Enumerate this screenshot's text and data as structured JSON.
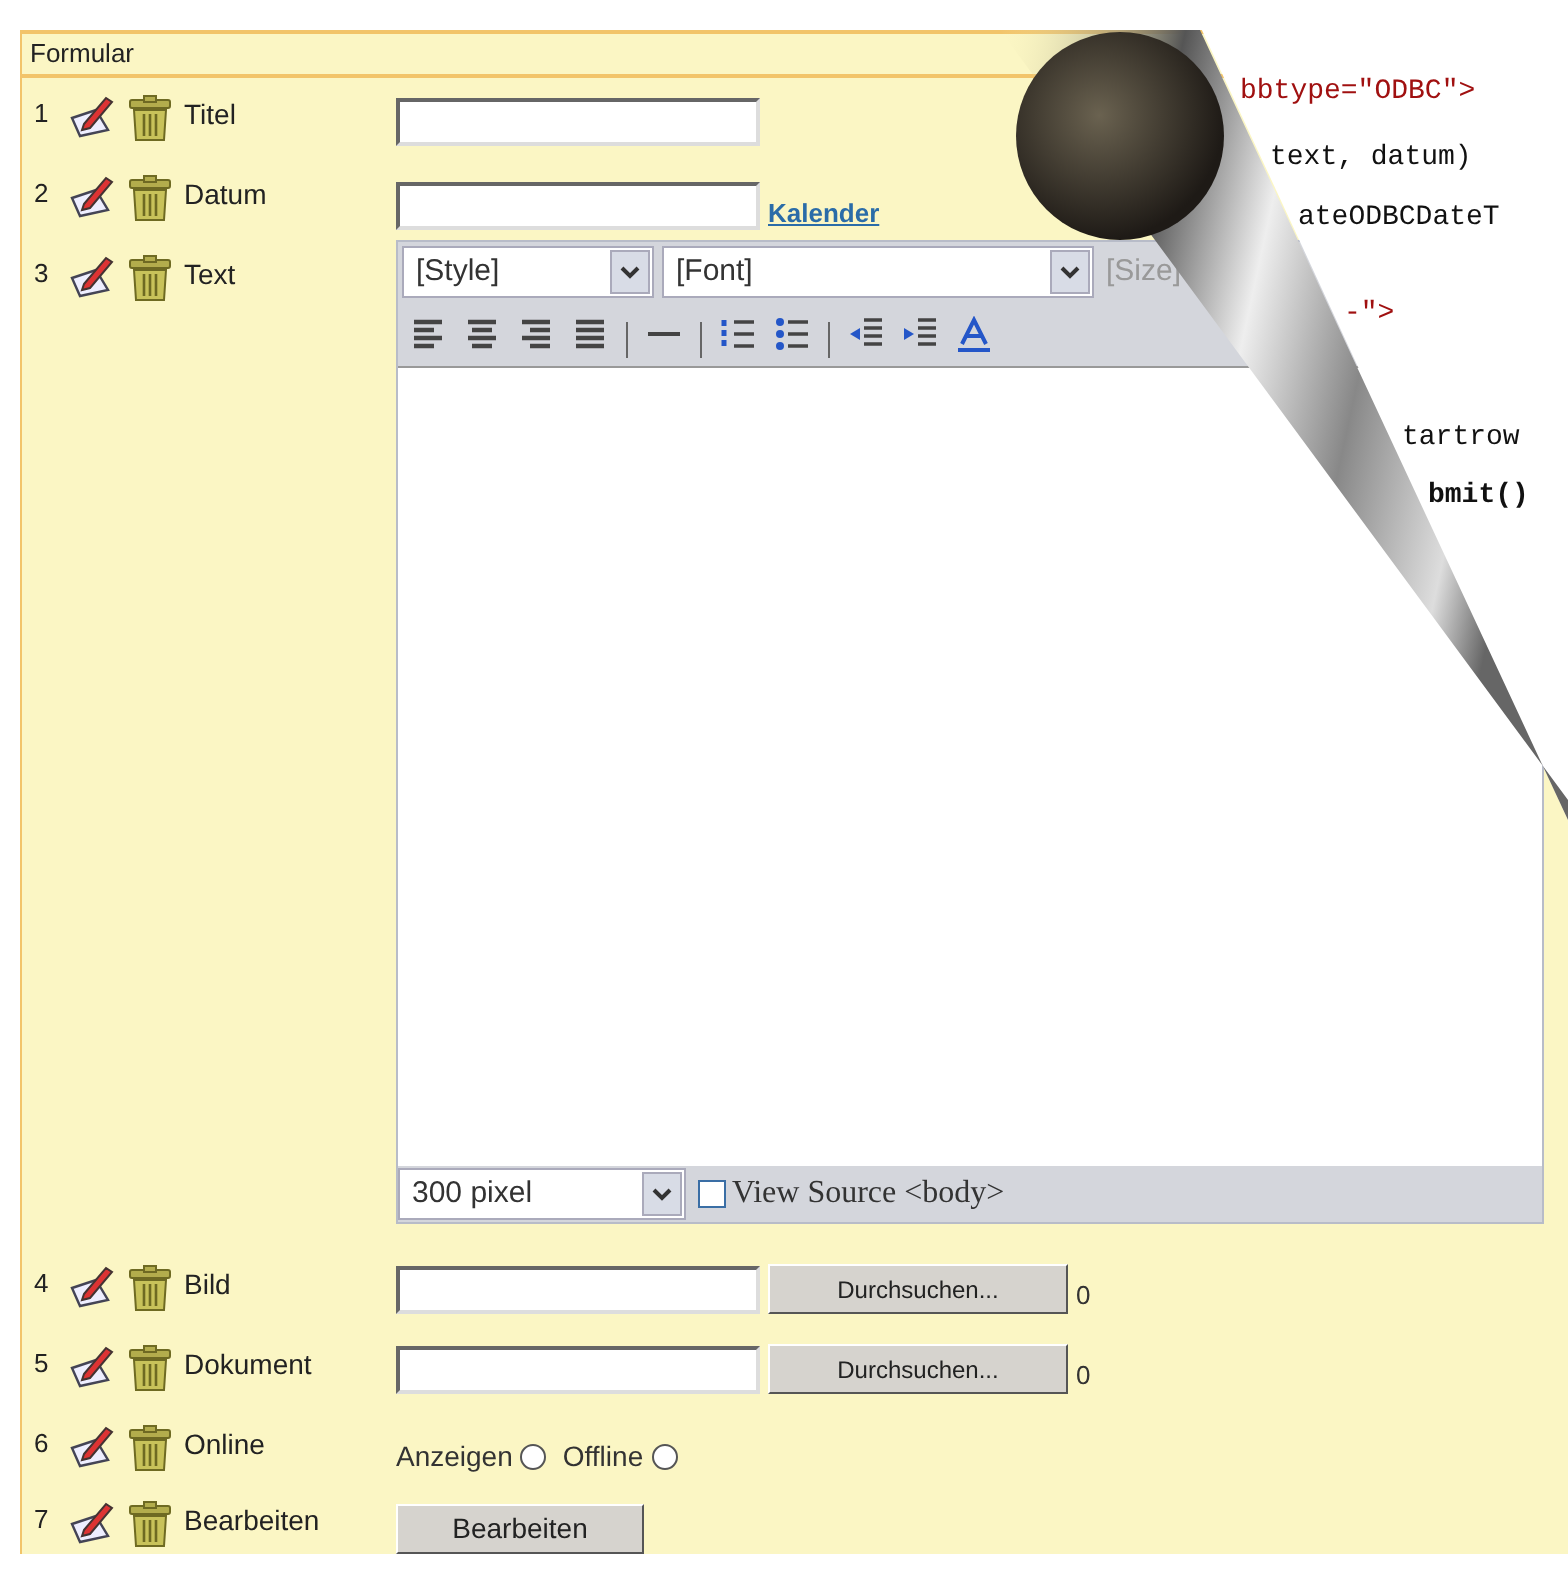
{
  "panel": {
    "title": "Formular"
  },
  "rows": [
    {
      "number": "1",
      "label": "Titel",
      "kind": "text"
    },
    {
      "number": "2",
      "label": "Datum",
      "kind": "date",
      "link": "Kalender"
    },
    {
      "number": "3",
      "label": "Text",
      "kind": "editor",
      "editor": {
        "style": "[Style]",
        "font": "[Font]",
        "size": "[Size]",
        "height": "300 pixel",
        "view_source": {
          "label": "View Source <body>",
          "checked": false
        }
      }
    },
    {
      "number": "4",
      "label": "Bild",
      "kind": "file",
      "button": "Durchsuchen...",
      "count": "0"
    },
    {
      "number": "5",
      "label": "Dokument",
      "kind": "file",
      "button": "Durchsuchen...",
      "count": "0"
    },
    {
      "number": "6",
      "label": "Online",
      "kind": "radio",
      "options": [
        {
          "label": "Anzeigen",
          "checked": false
        },
        {
          "label": "Offline",
          "checked": false
        }
      ]
    },
    {
      "number": "7",
      "label": "Bearbeiten",
      "kind": "button",
      "button": "Bearbeiten"
    }
  ],
  "code_behind": [
    {
      "text": "bbtype=\"ODBC\">",
      "kind": "attr"
    },
    {
      "text": "text, datum)",
      "kind": "plain"
    },
    {
      "text": "ateODBCDateT",
      "kind": "plain"
    },
    {
      "text": "-\">",
      "kind": "tag"
    },
    {
      "text": "tartrow",
      "kind": "plain"
    },
    {
      "text": "bmit()",
      "kind": "call"
    }
  ]
}
